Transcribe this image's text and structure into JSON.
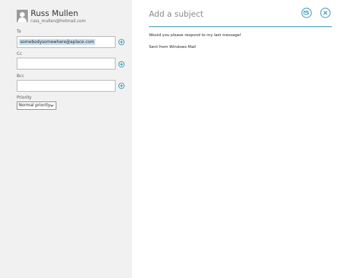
{
  "account": {
    "name": "Russ Mullen",
    "email": "russ_mullen@hotmail.com"
  },
  "fields": {
    "to_label": "To",
    "to_recipient": "somebodysomewhere@aplace.com",
    "cc_label": "Cc",
    "bcc_label": "Bcc",
    "priority_label": "Priority",
    "priority_value": "Normal priority"
  },
  "message": {
    "subject_placeholder": "Add a subject",
    "body_line1": "Would you please respond to my last message!",
    "body_line2": "Sent from Windows Mail"
  },
  "icons": {
    "send": "send-icon",
    "close": "close-icon",
    "add": "plus-circle-icon",
    "avatar": "user-avatar-icon",
    "dropdown": "chevron-down-icon"
  },
  "colors": {
    "accent": "#2b8fb0",
    "left_pane_bg": "#f1f1f1",
    "chip_bg": "#c9e2ee"
  }
}
